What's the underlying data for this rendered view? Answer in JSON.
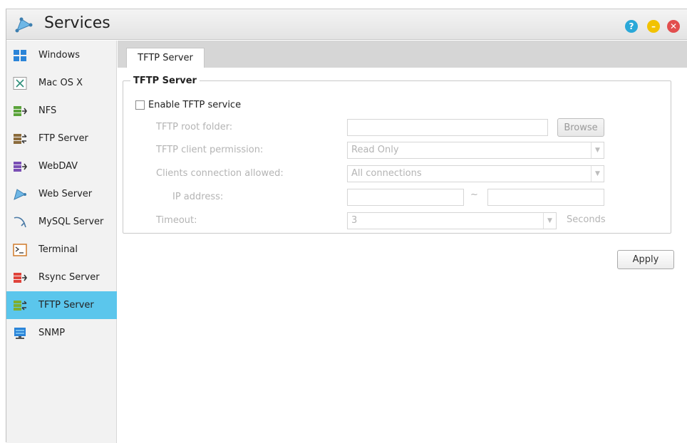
{
  "window": {
    "title": "Services"
  },
  "title_buttons": [
    {
      "name": "help",
      "glyph": "?"
    },
    {
      "name": "minimize",
      "glyph": "–"
    },
    {
      "name": "close",
      "glyph": "✕"
    }
  ],
  "sidebar": {
    "items": [
      {
        "label": "Windows",
        "icon": "windows-icon"
      },
      {
        "label": "Mac OS X",
        "icon": "macosx-icon"
      },
      {
        "label": "NFS",
        "icon": "nfs-icon"
      },
      {
        "label": "FTP Server",
        "icon": "ftp-server-icon"
      },
      {
        "label": "WebDAV",
        "icon": "webdav-icon"
      },
      {
        "label": "Web Server",
        "icon": "web-server-icon"
      },
      {
        "label": "MySQL Server",
        "icon": "mysql-icon"
      },
      {
        "label": "Terminal",
        "icon": "terminal-icon"
      },
      {
        "label": "Rsync Server",
        "icon": "rsync-icon"
      },
      {
        "label": "TFTP Server",
        "icon": "tftp-server-icon",
        "active": true
      },
      {
        "label": "SNMP",
        "icon": "snmp-icon"
      }
    ]
  },
  "tabs": [
    {
      "label": "TFTP Server",
      "active": true
    }
  ],
  "form": {
    "group_title": "TFTP Server",
    "enable_label": "Enable TFTP service",
    "enable_checked": false,
    "root_folder": {
      "label": "TFTP root folder:",
      "value": "",
      "browse_label": "Browse"
    },
    "client_permission": {
      "label": "TFTP client permission:",
      "value": "Read Only"
    },
    "connection_allowed": {
      "label": "Clients connection allowed:",
      "value": "All connections"
    },
    "ip_address": {
      "label": "IP address:",
      "from": "",
      "separator": "~",
      "to": ""
    },
    "timeout": {
      "label": "Timeout:",
      "value": "3",
      "unit": "Seconds"
    }
  },
  "apply_label": "Apply",
  "colors": {
    "accent": "#5bc6ec",
    "tab_bar": "#d6d6d6",
    "disabled_text": "#b4b4b4"
  }
}
